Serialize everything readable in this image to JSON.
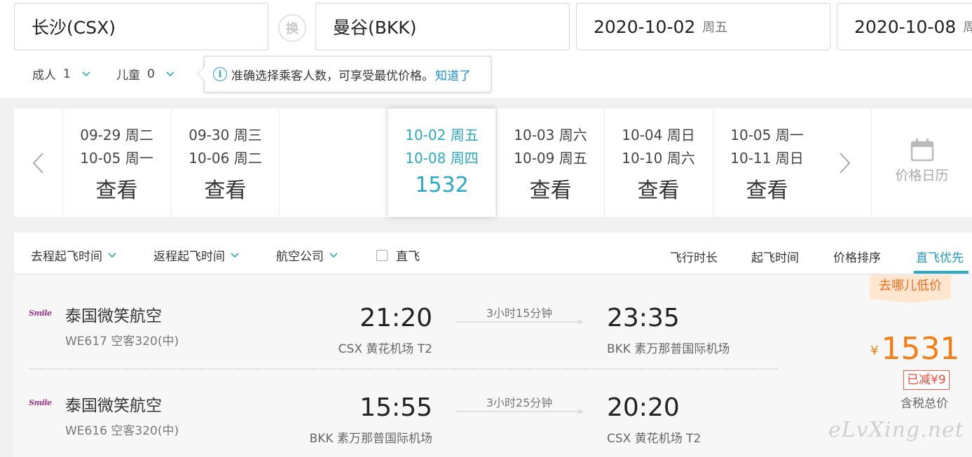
{
  "search": {
    "from": "长沙(CSX)",
    "swap_label": "换",
    "to": "曼谷(BKK)",
    "depart_date": "2020-10-02",
    "depart_weekday": "周五",
    "return_date": "2020-10-08",
    "return_weekday": "周四"
  },
  "passengers": {
    "adult_label": "成人",
    "adult_count": "1",
    "child_label": "儿童",
    "child_count": "0"
  },
  "tip": {
    "icon": "info-icon",
    "text": "准确选择乘客人数，可享受最优价格。",
    "link": "知道了"
  },
  "date_strip": {
    "cells": [
      {
        "depart": "09-29 周二",
        "return": "10-05 周一",
        "value": "查看"
      },
      {
        "depart": "09-30 周三",
        "return": "10-06 周二",
        "value": "查看"
      },
      {
        "depart": "10-02 周五",
        "return": "10-08 周四",
        "value": "1532"
      },
      {
        "depart": "10-03 周六",
        "return": "10-09 周五",
        "value": "查看"
      },
      {
        "depart": "10-04 周日",
        "return": "10-10 周六",
        "value": "查看"
      },
      {
        "depart": "10-05 周一",
        "return": "10-11 周日",
        "value": "查看"
      }
    ],
    "active_index": 2,
    "calendar_label": "价格日历"
  },
  "filters": {
    "depart_time": "去程起飞时间",
    "return_time": "返程起飞时间",
    "airline": "航空公司",
    "direct": "直飞"
  },
  "sort": {
    "duration": "飞行时长",
    "departure": "起飞时间",
    "price": "价格排序",
    "direct_first": "直飞优先",
    "active": "direct_first"
  },
  "flight": {
    "promo": "去哪儿低价",
    "legs": [
      {
        "logo_text": "Smile",
        "airline": "泰国微笑航空",
        "flight_no": "WE617 空客320(中)",
        "dep_time": "21:20",
        "dep_airport": "CSX 黄花机场 T2",
        "duration": "3小时15分钟",
        "arr_time": "23:35",
        "arr_airport": "BKK 素万那普国际机场"
      },
      {
        "logo_text": "Smile",
        "airline": "泰国微笑航空",
        "flight_no": "WE616 空客320(中)",
        "dep_time": "15:55",
        "dep_airport": "BKK 素万那普国际机场",
        "duration": "3小时25分钟",
        "arr_time": "20:20",
        "arr_airport": "CSX 黄花机场 T2"
      }
    ],
    "currency": "¥",
    "price": "1531",
    "discount": "已减¥9",
    "tax_note": "含税总价"
  },
  "watermark": "eLvXing.net",
  "colors": {
    "accent": "#29a9c6",
    "price": "#f57e14",
    "discount": "#f24a3a",
    "promo_bg": "#ffe7cf"
  }
}
